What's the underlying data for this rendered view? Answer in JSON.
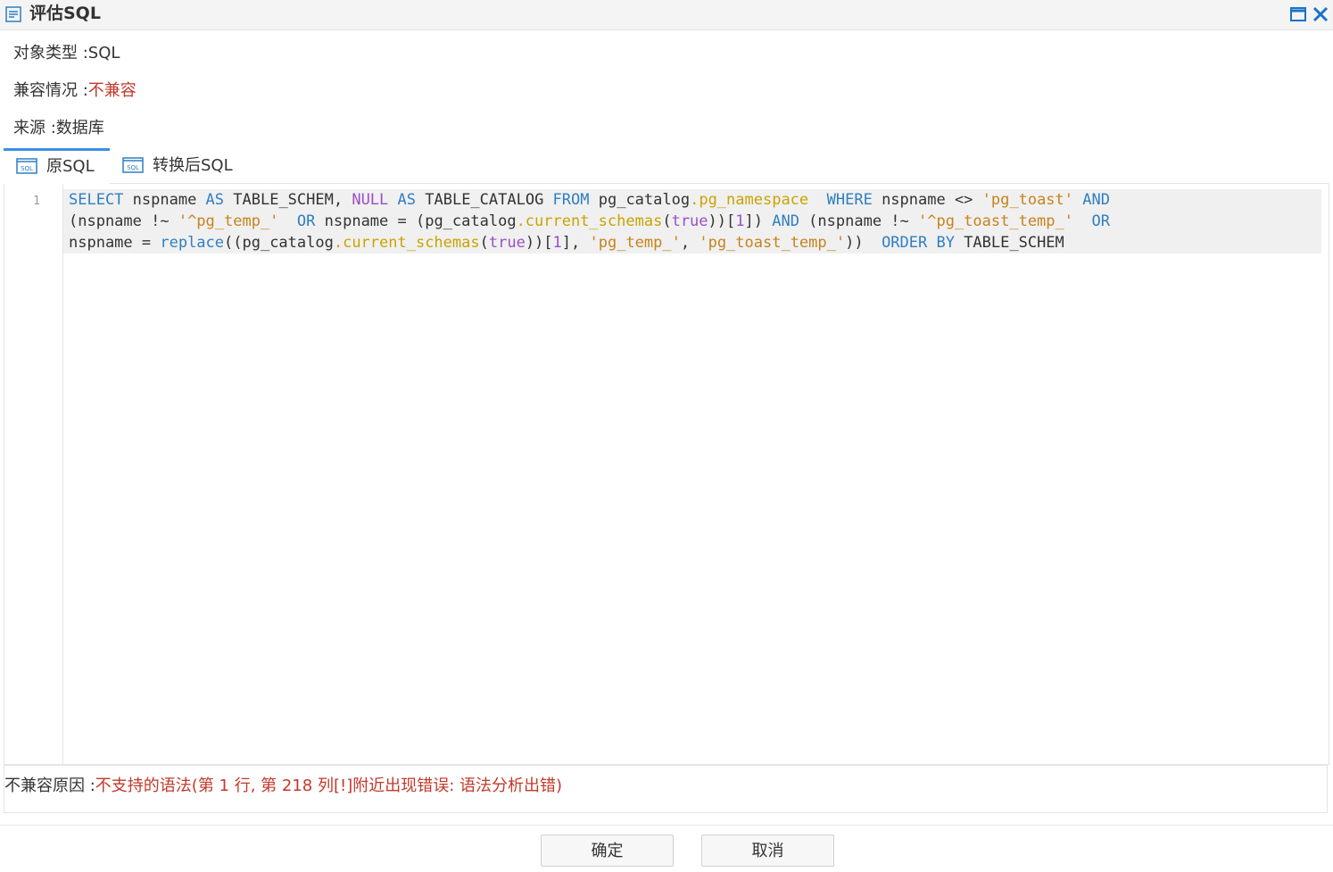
{
  "window": {
    "title": "评估SQL",
    "icon": "document-list-icon",
    "maximize_icon": "maximize-icon",
    "close_icon": "close-icon",
    "accent_color": "#1a73c8"
  },
  "info": {
    "object_type_label": "对象类型 :",
    "object_type_value": "SQL",
    "compat_label": "兼容情况 :",
    "compat_value": "不兼容",
    "source_label": "来源 :",
    "source_value": "数据库"
  },
  "tabs": [
    {
      "label": "原SQL",
      "icon": "sql-file-icon",
      "active": true
    },
    {
      "label": "转换后SQL",
      "icon": "sql-file-icon",
      "active": false
    }
  ],
  "editor": {
    "line_numbers": [
      "1"
    ],
    "sql_lines": [
      [
        {
          "t": "SELECT",
          "c": "kw"
        },
        {
          "t": " nspname ",
          "c": ""
        },
        {
          "t": "AS",
          "c": "kw"
        },
        {
          "t": " TABLE_SCHEM, ",
          "c": ""
        },
        {
          "t": "NULL",
          "c": "nul"
        },
        {
          "t": " ",
          "c": ""
        },
        {
          "t": "AS",
          "c": "kw"
        },
        {
          "t": " TABLE_CATALOG ",
          "c": ""
        },
        {
          "t": "FROM",
          "c": "kw"
        },
        {
          "t": " pg_catalog",
          "c": ""
        },
        {
          "t": ".pg_namespace",
          "c": "fn"
        },
        {
          "t": "  ",
          "c": ""
        },
        {
          "t": "WHERE",
          "c": "kw"
        },
        {
          "t": " nspname <> ",
          "c": ""
        },
        {
          "t": "'pg_toast'",
          "c": "str"
        },
        {
          "t": " ",
          "c": ""
        },
        {
          "t": "AND",
          "c": "kw"
        }
      ],
      [
        {
          "t": "(nspname !~ ",
          "c": ""
        },
        {
          "t": "'^pg_temp_'",
          "c": "str"
        },
        {
          "t": "  ",
          "c": ""
        },
        {
          "t": "OR",
          "c": "kw"
        },
        {
          "t": " nspname = (pg_catalog",
          "c": ""
        },
        {
          "t": ".current_schemas",
          "c": "fn"
        },
        {
          "t": "(",
          "c": ""
        },
        {
          "t": "true",
          "c": "nul"
        },
        {
          "t": "))[",
          "c": ""
        },
        {
          "t": "1",
          "c": "num"
        },
        {
          "t": "]) ",
          "c": ""
        },
        {
          "t": "AND",
          "c": "kw"
        },
        {
          "t": " (nspname !~ ",
          "c": ""
        },
        {
          "t": "'^pg_toast_temp_'",
          "c": "str"
        },
        {
          "t": "  ",
          "c": ""
        },
        {
          "t": "OR",
          "c": "kw"
        }
      ],
      [
        {
          "t": "nspname = ",
          "c": ""
        },
        {
          "t": "replace",
          "c": "bi"
        },
        {
          "t": "((pg_catalog",
          "c": ""
        },
        {
          "t": ".current_schemas",
          "c": "fn"
        },
        {
          "t": "(",
          "c": ""
        },
        {
          "t": "true",
          "c": "nul"
        },
        {
          "t": "))[",
          "c": ""
        },
        {
          "t": "1",
          "c": "num"
        },
        {
          "t": "], ",
          "c": ""
        },
        {
          "t": "'pg_temp_'",
          "c": "str"
        },
        {
          "t": ", ",
          "c": ""
        },
        {
          "t": "'pg_toast_temp_'",
          "c": "str"
        },
        {
          "t": "))  ",
          "c": ""
        },
        {
          "t": "ORDER BY",
          "c": "kw"
        },
        {
          "t": " TABLE_SCHEM",
          "c": ""
        }
      ]
    ],
    "colors": {
      "keyword": "#2f7fc2",
      "null_bool": "#9b4fc7",
      "function": "#c9a400",
      "string": "#c7831b"
    }
  },
  "reason": {
    "label": "不兼容原因 :",
    "value": "不支持的语法(第 1 行, 第 218 列[!]附近出现错误: 语法分析出错)"
  },
  "buttons": {
    "ok": "确定",
    "cancel": "取消"
  }
}
